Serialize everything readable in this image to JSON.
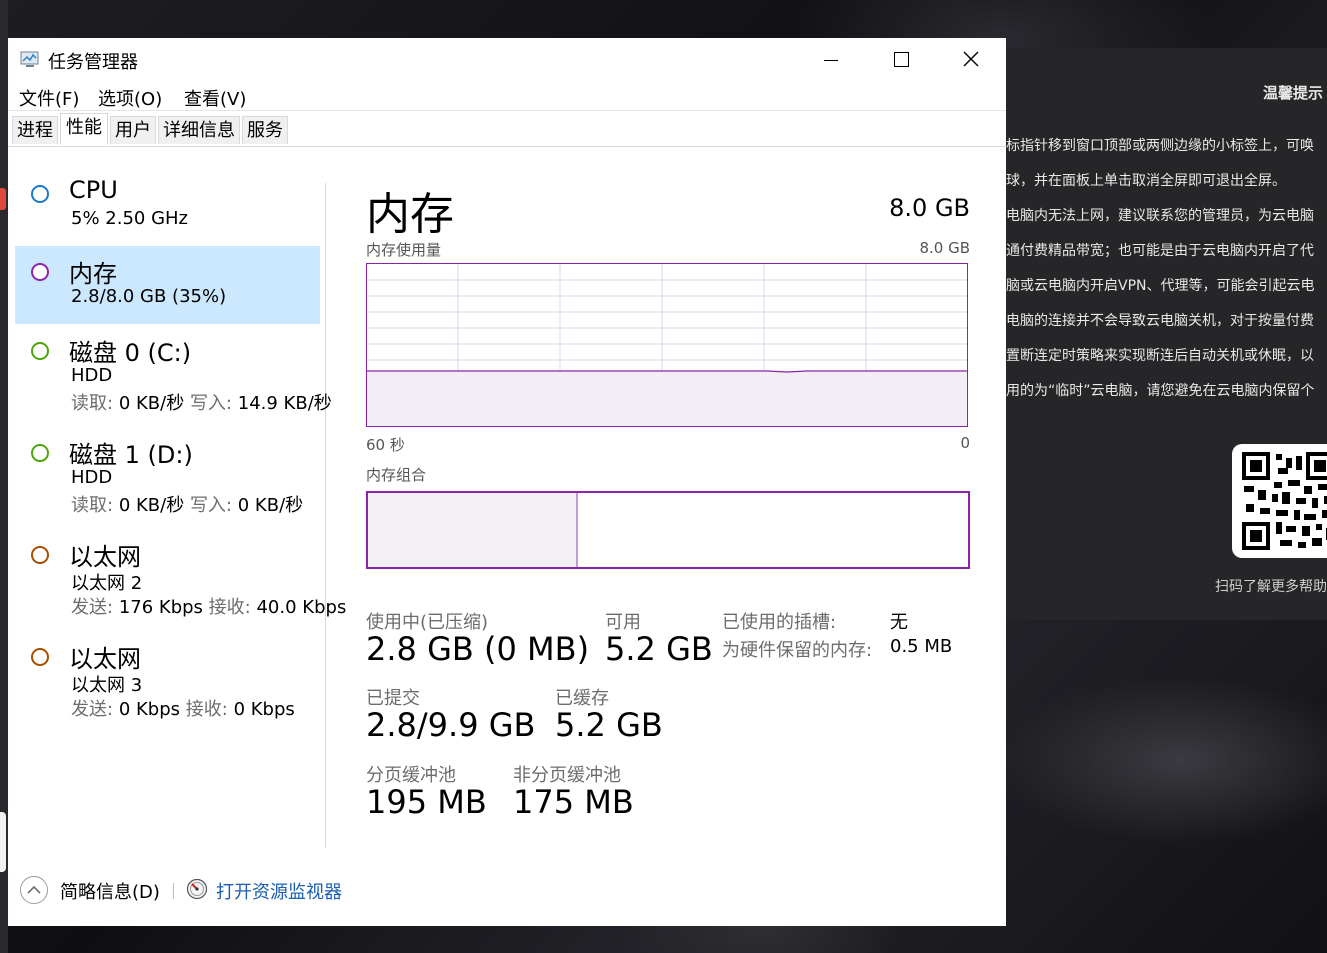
{
  "side_panel": {
    "title": "温馨提示",
    "lines": [
      "标指针移到窗口顶部或两侧边缘的小标签上，可唤",
      "球，并在面板上单击取消全屏即可退出全屏。",
      "电脑内无法上网，建议联系您的管理员，为云电脑",
      "通付费精品带宽；也可能是由于云电脑内开启了代",
      "脑或云电脑内开启VPN、代理等，可能会引起云电",
      "电脑的连接并不会导致云电脑关机，对于按量付费",
      "置断连定时策略来实现断连后自动关机或休眠，以",
      "用的为“临时”云电脑，请您避免在云电脑内保留个"
    ],
    "qr_caption": "扫码了解更多帮助"
  },
  "window": {
    "title": "任务管理器",
    "menu": [
      "文件(F)",
      "选项(O)",
      "查看(V)"
    ],
    "tabs": [
      "进程",
      "性能",
      "用户",
      "详细信息",
      "服务"
    ],
    "active_tab": "性能"
  },
  "resources": [
    {
      "title": "CPU",
      "sub1": "5%  2.50 GHz",
      "ring_color": "#1979ca"
    },
    {
      "title": "内存",
      "sub1": "2.8/8.0 GB (35%)",
      "ring_color": "#8b24a8",
      "selected": true
    },
    {
      "title": "磁盘 0 (C:)",
      "sub1": "HDD",
      "label_a": "读取:",
      "value_a": "0 KB/秒",
      "label_b": "写入:",
      "value_b": "14.9 KB/秒",
      "ring_color": "#4da60c"
    },
    {
      "title": "磁盘 1 (D:)",
      "sub1": "HDD",
      "label_a": "读取:",
      "value_a": "0 KB/秒",
      "label_b": "写入:",
      "value_b": "0 KB/秒",
      "ring_color": "#4da60c"
    },
    {
      "title": "以太网",
      "sub1": "以太网 2",
      "label_a": "发送:",
      "value_a": "176 Kbps",
      "label_b": "接收:",
      "value_b": "40.0 Kbps",
      "ring_color": "#a74f01"
    },
    {
      "title": "以太网",
      "sub1": "以太网 3",
      "label_a": "发送:",
      "value_a": "0 Kbps",
      "label_b": "接收:",
      "value_b": "0 Kbps",
      "ring_color": "#a74f01"
    }
  ],
  "memory": {
    "heading": "内存",
    "total": "8.0 GB",
    "usage_label": "内存使用量",
    "usage_max": "8.0 GB",
    "time_left": "60 秒",
    "time_right": "0",
    "composition_label": "内存组合",
    "used_fraction": 0.35,
    "in_use_label": "使用中(已压缩)",
    "in_use_value": "2.8 GB (0 MB)",
    "available_label": "可用",
    "available_value": "5.2 GB",
    "slots_label": "已使用的插槽:",
    "slots_value": "无",
    "reserved_label": "为硬件保留的内存:",
    "reserved_value": "0.5 MB",
    "committed_label": "已提交",
    "committed_value": "2.8/9.9 GB",
    "cached_label": "已缓存",
    "cached_value": "5.2 GB",
    "paged_label": "分页缓冲池",
    "paged_value": "195 MB",
    "nonpaged_label": "非分页缓冲池",
    "nonpaged_value": "175 MB"
  },
  "footer": {
    "fewer_details": "简略信息(D)",
    "open_resmon": "打开资源监视器"
  },
  "colors": {
    "memory_accent": "#8b24a8",
    "selected_bg": "#cce8ff",
    "link": "#1a5fb4"
  }
}
